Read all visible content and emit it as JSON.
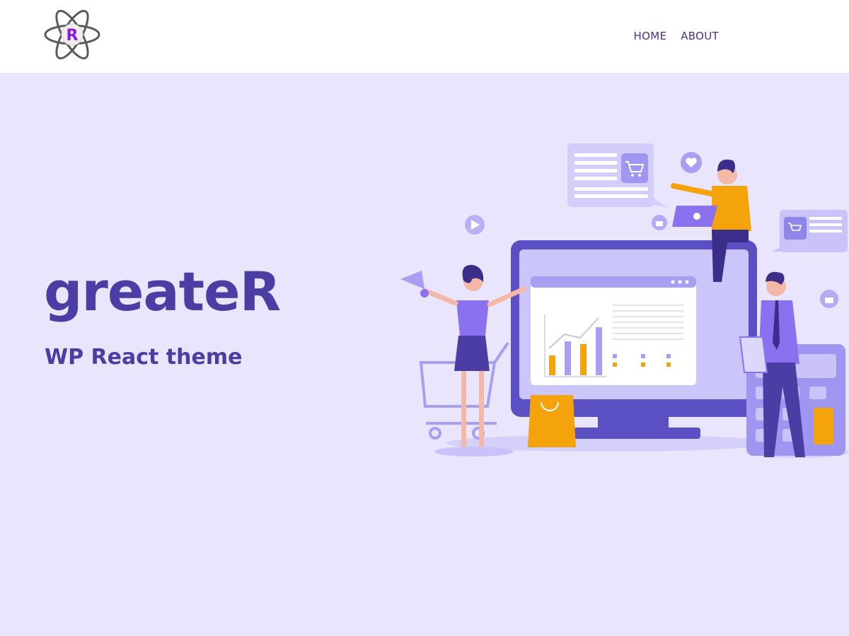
{
  "header": {
    "logo_letter": "R",
    "nav": [
      {
        "label": "HOME"
      },
      {
        "label": "ABOUT"
      }
    ]
  },
  "hero": {
    "title": "greateR",
    "subtitle": "WP React theme"
  },
  "colors": {
    "page_bg": "#e8e5fd",
    "header_bg": "#ffffff",
    "brand": "#4a3da3",
    "nav_text": "#4a2f8f",
    "accent_orange": "#f5a30a",
    "illustration_purple": "#5b4fc4",
    "illustration_light": "#b9b3f6"
  }
}
